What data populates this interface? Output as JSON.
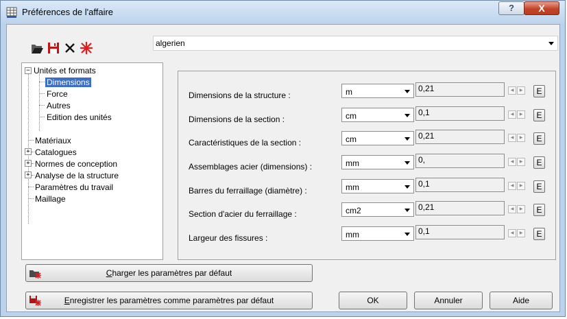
{
  "window": {
    "title": "Préférences de l'affaire",
    "help_button": "?",
    "close_button": "X"
  },
  "toolbar": {
    "open_icon": "folder-open-icon",
    "save_icon": "floppy-disk-icon",
    "delete_icon": "x-delete-icon",
    "new_icon": "red-star-icon"
  },
  "preset_combo": {
    "value": "algerien"
  },
  "tree": {
    "items": [
      {
        "label": "Unités et formats",
        "expanded": true
      },
      {
        "label": "Dimensions",
        "selected": true
      },
      {
        "label": "Force"
      },
      {
        "label": "Autres"
      },
      {
        "label": "Edition des unités"
      },
      {
        "label": "Matériaux"
      },
      {
        "label": "Catalogues",
        "expandable": true
      },
      {
        "label": "Normes de conception",
        "expandable": true
      },
      {
        "label": "Analyse de la structure",
        "expandable": true
      },
      {
        "label": "Paramètres du travail"
      },
      {
        "label": "Maillage"
      }
    ]
  },
  "dimensions": {
    "rows": [
      {
        "label": "Dimensions de la structure :",
        "unit": "m",
        "value": "0,21",
        "edit": "E"
      },
      {
        "label": "Dimensions de la section :",
        "unit": "cm",
        "value": "0,1",
        "edit": "E"
      },
      {
        "label": "Caractéristiques de la section :",
        "unit": "cm",
        "value": "0,21",
        "edit": "E"
      },
      {
        "label": "Assemblages acier (dimensions) :",
        "unit": "mm",
        "value": "0,",
        "edit": "E"
      },
      {
        "label": "Barres du ferraillage (diamètre) :",
        "unit": "mm",
        "value": "0,1",
        "edit": "E"
      },
      {
        "label": "Section d'acier du ferraillage :",
        "unit": "cm2",
        "value": "0,21",
        "edit": "E"
      },
      {
        "label": "Largeur des fissures :",
        "unit": "mm",
        "value": "0,1",
        "edit": "E"
      }
    ]
  },
  "buttons": {
    "load_defaults": {
      "pre": "",
      "mnemonic": "C",
      "post": "harger les paramètres par défaut"
    },
    "save_defaults": {
      "pre": "",
      "mnemonic": "E",
      "post": "nregistrer les paramètres comme paramètres par défaut"
    },
    "ok": "OK",
    "cancel": "Annuler",
    "help": "Aide"
  },
  "colors": {
    "title_bar": "#bcd3ec",
    "close_button": "#c4442a",
    "selection": "#3a6fc5",
    "dialog_bg": "#f0f0f0"
  }
}
